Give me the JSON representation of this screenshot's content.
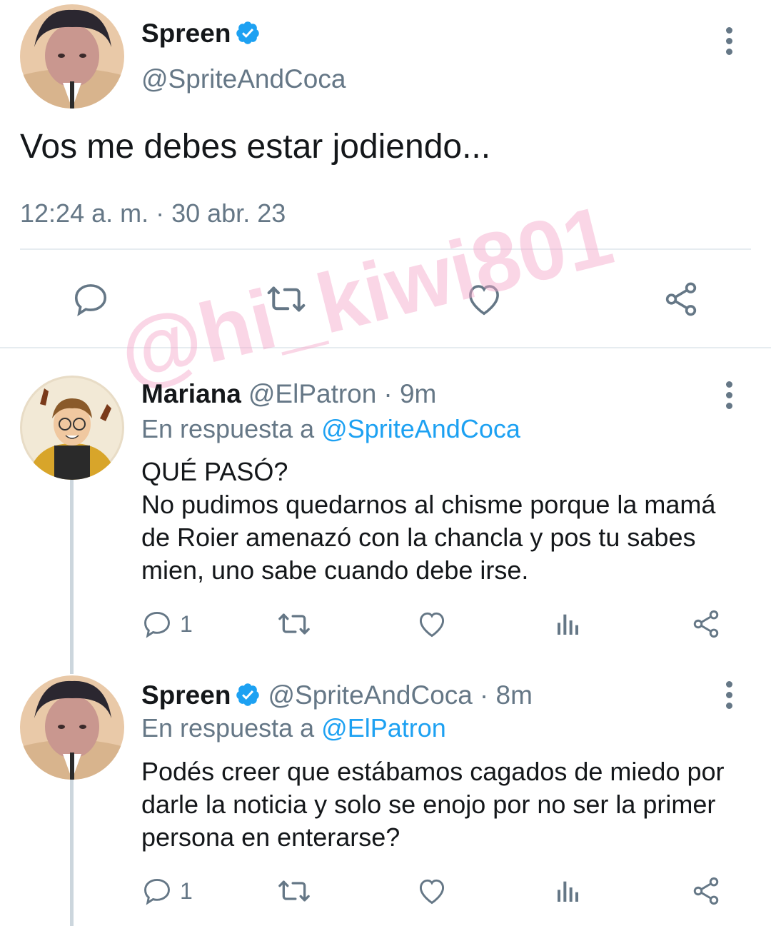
{
  "main_tweet": {
    "author_name": "Spreen",
    "author_handle": "@SpriteAndCoca",
    "text": "Vos me debes estar jodiendo...",
    "timestamp": "12:24 a. m. · 30 abr. 23",
    "actions": [
      "comment-icon",
      "retweet-icon",
      "like-icon",
      "share-icon"
    ]
  },
  "watermark": "@hi_kiwi801",
  "replies": [
    {
      "author_name": "Mariana",
      "author_handle": "@ElPatron",
      "time": "· 9m",
      "reply_prefix": "En respuesta a",
      "reply_to": "@SpriteAndCoca",
      "text": "QUÉ PASÓ?\nNo pudimos quedarnos al chisme porque la mamá de Roier amenazó con la chancla y pos tu sabes mien, uno sabe cuando debe irse.",
      "reply_count": "1"
    },
    {
      "author_name": "Spreen",
      "author_handle": "@SpriteAndCoca",
      "time": "· 8m",
      "reply_prefix": "En respuesta a",
      "reply_to": "@ElPatron",
      "text": "Podés creer que estábamos cagados de miedo por darle la noticia y solo se enojo por no ser la primer persona en enterarse?",
      "reply_count": "1"
    }
  ],
  "colors": {
    "verified": "#1da1f2",
    "link": "#1da1f2",
    "secondary_text": "#657786",
    "watermark": "#f4a6c9"
  }
}
